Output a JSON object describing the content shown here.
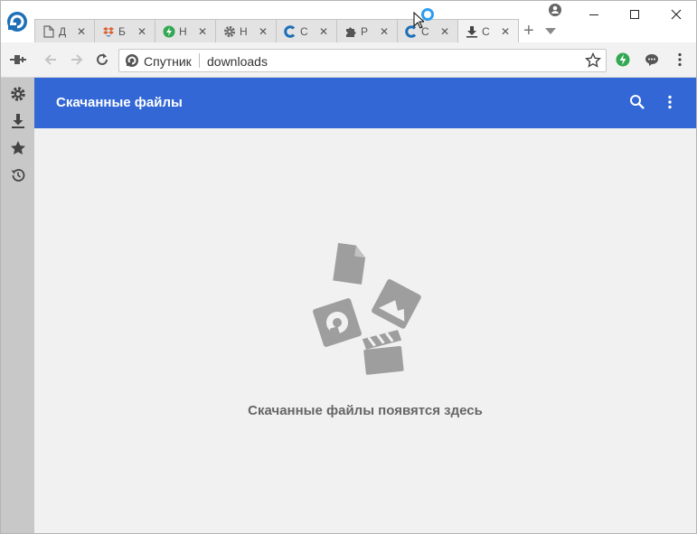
{
  "tabs": [
    {
      "title": "Д",
      "icon": "document-icon"
    },
    {
      "title": "Б",
      "icon": "dropbox-icon"
    },
    {
      "title": "Н",
      "icon": "lightning-icon"
    },
    {
      "title": "Н",
      "icon": "gear-icon"
    },
    {
      "title": "С",
      "icon": "sputnik-c-icon"
    },
    {
      "title": "Р",
      "icon": "puzzle-icon"
    },
    {
      "title": "С",
      "icon": "sputnik-c-icon"
    },
    {
      "title": "С",
      "icon": "download-icon",
      "active": true
    }
  ],
  "omnibox": {
    "brand": "Спутник",
    "url": "downloads"
  },
  "page": {
    "title": "Скачанные файлы",
    "empty_message": "Скачанные файлы появятся здесь"
  },
  "colors": {
    "header": "#3367d6",
    "sidebar": "#c8c8c8",
    "content_bg": "#f1f1f1",
    "accent": "#1d6fb8"
  }
}
